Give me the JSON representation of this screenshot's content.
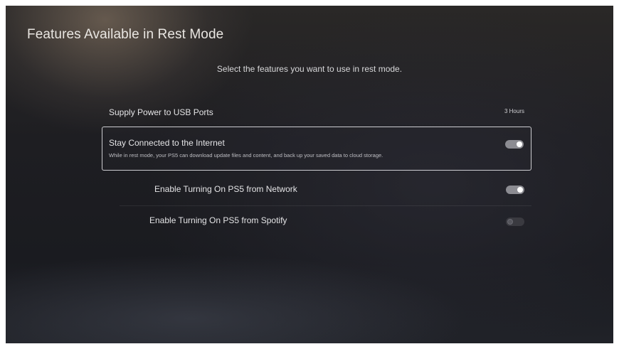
{
  "header": {
    "title": "Features Available in Rest Mode",
    "subtitle": "Select the features you want to use in rest mode."
  },
  "settings": [
    {
      "label": "Supply Power to USB Ports",
      "value": "3 Hours"
    },
    {
      "label": "Stay Connected to the Internet",
      "description": "While in rest mode, your PS5 can download update files and content, and back up your saved data to cloud storage.",
      "toggle": "on",
      "focused": true
    },
    {
      "label": "Enable Turning On PS5 from Network",
      "toggle": "on"
    },
    {
      "label": "Enable Turning On PS5 from Spotify",
      "toggle": "off"
    }
  ],
  "colors": {
    "toggle_on": "#8c8c92",
    "toggle_off": "#3a3a40",
    "focus_border": "#ebebf0"
  }
}
